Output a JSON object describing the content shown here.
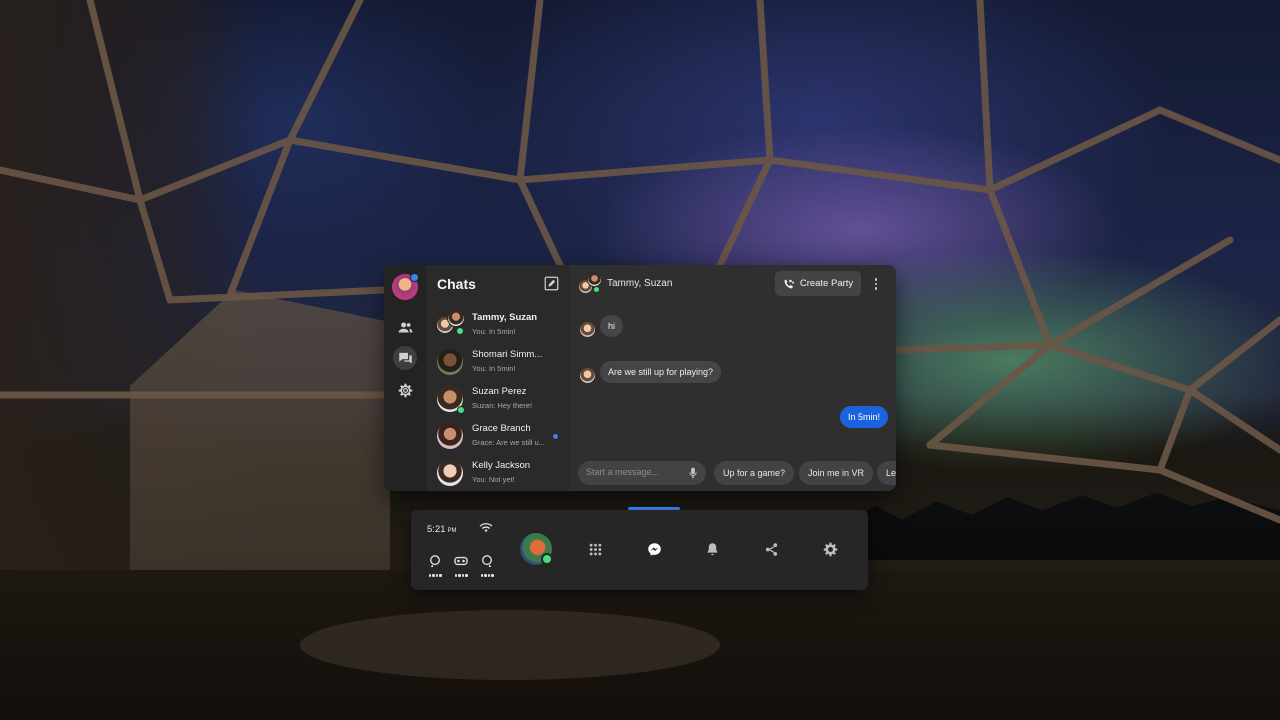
{
  "chats": {
    "title": "Chats",
    "conversations": [
      {
        "name": "Tammy, Suzan",
        "preview": "You: In 5min!",
        "bold": true
      },
      {
        "name": "Shomari Simm...",
        "preview": "You: In 5min!"
      },
      {
        "name": "Suzan Perez",
        "preview": "Suzan: Hey there!"
      },
      {
        "name": "Grace Branch",
        "preview": "Grace: Are we still u...",
        "unread": true
      },
      {
        "name": "Kelly Jackson",
        "preview": "You: Not yet!"
      }
    ]
  },
  "conversation": {
    "header_name": "Tammy, Suzan",
    "create_party_label": "Create Party",
    "messages": [
      {
        "text": "hi",
        "mine": false
      },
      {
        "text": "Are we still up for playing?",
        "mine": false
      },
      {
        "text": "In 5min!",
        "mine": true
      }
    ],
    "composer_placeholder": "Start a message...",
    "quick_replies": [
      "Up for a game?",
      "Join me in VR",
      "Le"
    ]
  },
  "dock": {
    "time": "5:21",
    "ampm": "PM"
  },
  "colors": {
    "accent": "#1d62dd",
    "online": "#4ade80",
    "unread": "#3b82f6"
  },
  "icons": {
    "rail": [
      "people-icon",
      "chat-icon",
      "gear-icon"
    ],
    "dock": [
      "apps-grid-icon",
      "messenger-icon",
      "bell-icon",
      "share-icon",
      "settings-icon"
    ]
  }
}
